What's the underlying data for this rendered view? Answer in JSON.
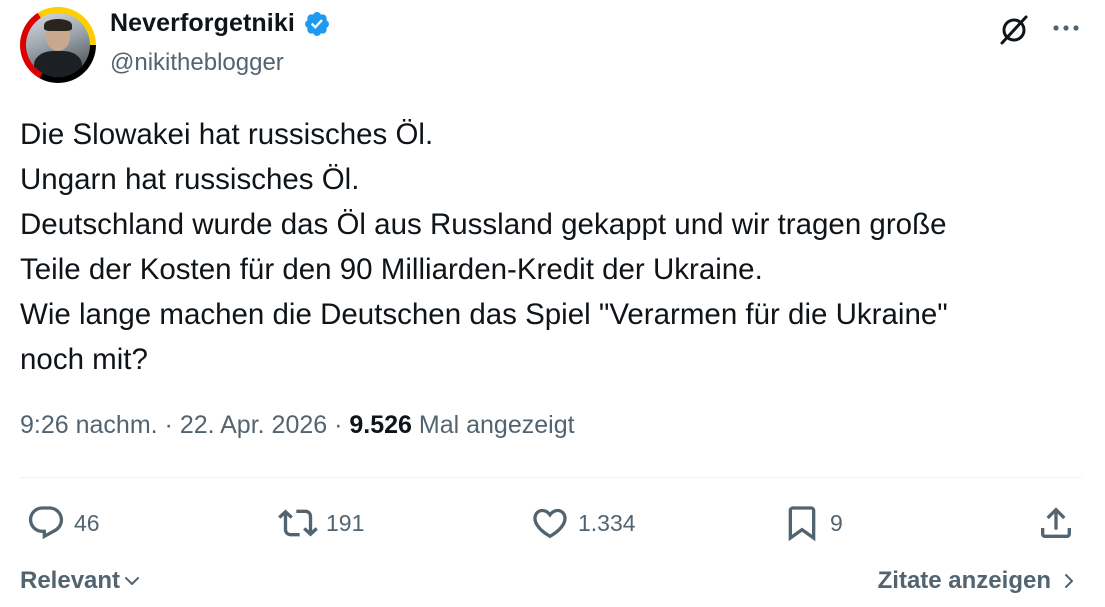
{
  "author": {
    "display_name": "Neverforgetniki",
    "handle": "@nikitheblogger",
    "verified": true,
    "verified_color": "#1d9bf0"
  },
  "header_icons": [
    "grok-icon",
    "more-icon"
  ],
  "tweet": {
    "lines": [
      "Die Slowakei hat russisches Öl.",
      "Ungarn hat russisches Öl.",
      "Deutschland wurde das Öl aus Russland gekappt und wir tragen große",
      "Teile der Kosten für den 90 Milliarden-Kredit der Ukraine.",
      "Wie lange machen die Deutschen das Spiel \"Verarmen für die Ukraine\"",
      "noch mit?"
    ]
  },
  "meta": {
    "time": "9:26 nachm.",
    "separator": " · ",
    "date": "22. Apr. 2026",
    "views": "9.526",
    "views_label": " Mal angezeigt"
  },
  "actions": {
    "replies": "46",
    "reposts": "191",
    "likes": "1.334",
    "bookmarks": "9"
  },
  "footer": {
    "sort_label": "Relevant",
    "quotes_label": "Zitate anzeigen"
  },
  "colors": {
    "text": "#0f1419",
    "secondary": "#536471",
    "divider": "#eff3f4"
  }
}
